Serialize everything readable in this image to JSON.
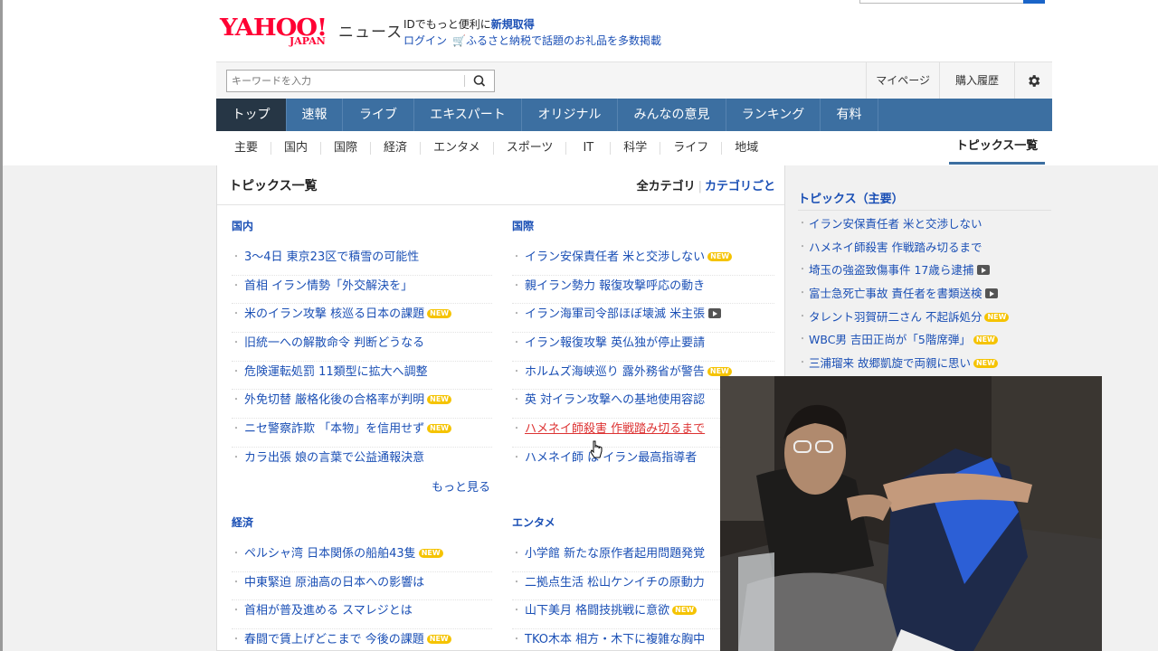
{
  "header": {
    "logo_text": "YAHOO!",
    "logo_sub": "JAPAN",
    "service_name": "ニュース",
    "id_promo_prefix": "IDでもっと便利に",
    "id_promo_link": "新規取得",
    "login": "ログイン",
    "furusato": "ふるさと納税で話題のお礼品を多数掲載"
  },
  "search": {
    "placeholder": "キーワードを入力"
  },
  "toplinks": {
    "mypage": "マイページ",
    "history": "購入履歴"
  },
  "nav": {
    "items": [
      "トップ",
      "速報",
      "ライブ",
      "エキスパート",
      "オリジナル",
      "みんなの意見",
      "ランキング",
      "有料"
    ]
  },
  "subnav": {
    "items": [
      "主要",
      "国内",
      "国際",
      "経済",
      "エンタメ",
      "スポーツ",
      "IT",
      "科学",
      "ライフ",
      "地域"
    ],
    "current": "トピックス一覧"
  },
  "main": {
    "title": "トピックス一覧",
    "all_category": "全カテゴリ",
    "by_category": "カテゴリごと",
    "more": "もっと見る",
    "sections": [
      {
        "heading": "国内",
        "items": [
          {
            "text": "3～4日 東京23区で積雪の可能性",
            "badge": ""
          },
          {
            "text": "首相 イラン情勢「外交解決を」",
            "badge": ""
          },
          {
            "text": "米のイラン攻撃 核巡る日本の課題",
            "badge": "NEW"
          },
          {
            "text": "旧統一への解散命令 判断どうなる",
            "badge": ""
          },
          {
            "text": "危険運転処罰 11類型に拡大へ調整",
            "badge": ""
          },
          {
            "text": "外免切替 厳格化後の合格率が判明",
            "badge": "NEW"
          },
          {
            "text": "ニセ警察詐欺 「本物」を信用せず",
            "badge": "NEW"
          },
          {
            "text": "カラ出張 娘の言葉で公益通報決意",
            "badge": ""
          }
        ]
      },
      {
        "heading": "国際",
        "items": [
          {
            "text": "イラン安保責任者 米と交渉しない",
            "badge": "NEW"
          },
          {
            "text": "親イラン勢力 報復攻撃呼応の動き",
            "badge": ""
          },
          {
            "text": "イラン海軍司令部ほぼ壊滅 米主張",
            "badge": "video"
          },
          {
            "text": "イラン報復攻撃 英仏独が停止要請",
            "badge": ""
          },
          {
            "text": "ホルムズ海峡巡り 露外務省が警告",
            "badge": "NEW"
          },
          {
            "text": "英 対イラン攻撃への基地使用容認",
            "badge": ""
          },
          {
            "text": "ハメネイ師殺害 作戦踏み切るまで",
            "badge": ""
          },
          {
            "text": "ハメネイ師 は イラン最高指導者",
            "badge": ""
          }
        ]
      },
      {
        "heading": "経済",
        "items": [
          {
            "text": "ペルシャ湾 日本関係の船舶43隻",
            "badge": "NEW"
          },
          {
            "text": "中東緊迫 原油高の日本への影響は",
            "badge": ""
          },
          {
            "text": "首相が普及進める スマレジとは",
            "badge": ""
          },
          {
            "text": "春闘で賃上げどこまで 今後の課題",
            "badge": "NEW"
          }
        ]
      },
      {
        "heading": "エンタメ",
        "items": [
          {
            "text": "小学館 新たな原作者起用問題発覚",
            "badge": ""
          },
          {
            "text": "二拠点生活 松山ケンイチの原動力",
            "badge": ""
          },
          {
            "text": "山下美月 格闘技挑戦に意欲",
            "badge": "NEW"
          },
          {
            "text": "TKO木本 相方・木下に複雑な胸中",
            "badge": ""
          }
        ]
      }
    ]
  },
  "side": {
    "heading": "トピックス（主要）",
    "items": [
      {
        "text": "イラン安保責任者 米と交渉しない",
        "badge": ""
      },
      {
        "text": "ハメネイ師殺害 作戦踏み切るまで",
        "badge": ""
      },
      {
        "text": "埼玉の強盗致傷事件 17歳ら逮捕",
        "badge": "video"
      },
      {
        "text": "富士急死亡事故 責任者を書類送検",
        "badge": "video"
      },
      {
        "text": "タレント羽賀研二さん 不起訴処分",
        "badge": "NEW"
      },
      {
        "text": "WBC男 吉田正尚が「5階席弾」",
        "badge": "NEW"
      },
      {
        "text": "三浦瑠来 故郷凱旋で両親に思い",
        "badge": "NEW"
      }
    ]
  },
  "colors": {
    "nav_bg": "#3c6fa1",
    "nav_active": "#263645",
    "link": "#1a4fb5",
    "brand": "#ff0033",
    "new_badge": "#f5c300"
  }
}
